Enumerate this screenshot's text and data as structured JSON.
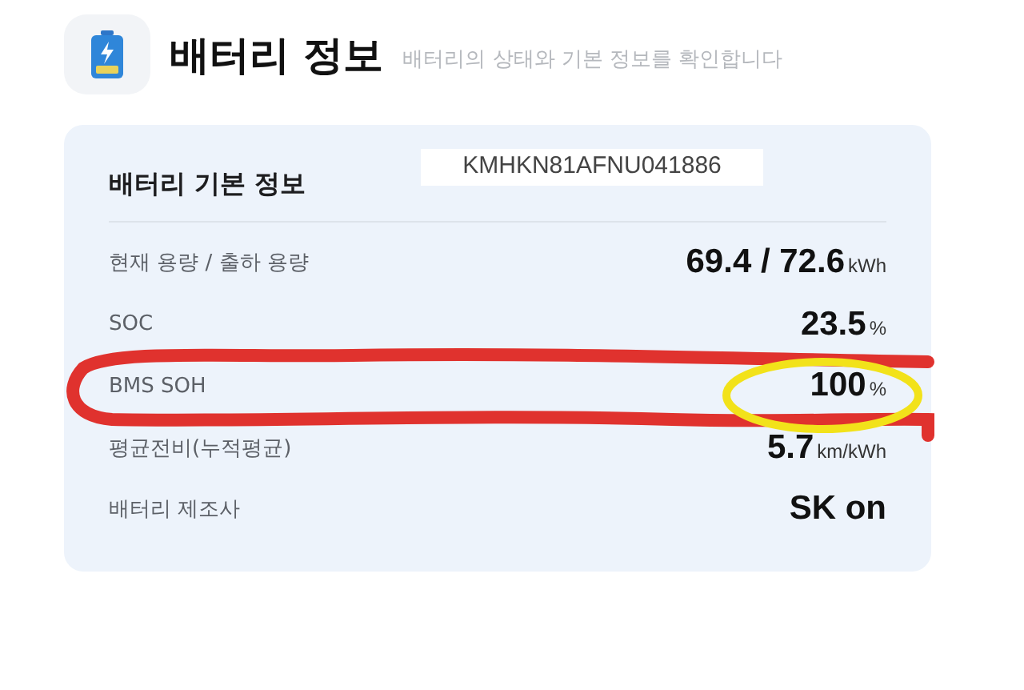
{
  "header": {
    "title": "배터리 정보",
    "subtitle": "배터리의 상태와 기본 정보를 확인합니다"
  },
  "card": {
    "title": "배터리 기본 정보",
    "vin": "KMHKN81AFNU041886",
    "rows": [
      {
        "label": "현재 용량 / 출하 용량",
        "value": "69.4 / 72.6",
        "unit": "kWh"
      },
      {
        "label": "SOC",
        "value": "23.5",
        "unit": "%"
      },
      {
        "label": "BMS SOH",
        "value": "100",
        "unit": "%"
      },
      {
        "label": "평균전비(누적평균)",
        "value": "5.7",
        "unit": "km/kWh"
      },
      {
        "label": "배터리 제조사",
        "value": "SK on"
      }
    ]
  },
  "annotations": [
    {
      "kind": "loop",
      "color": "#e0322e"
    },
    {
      "kind": "ellipse",
      "color": "#f2e21a"
    }
  ]
}
